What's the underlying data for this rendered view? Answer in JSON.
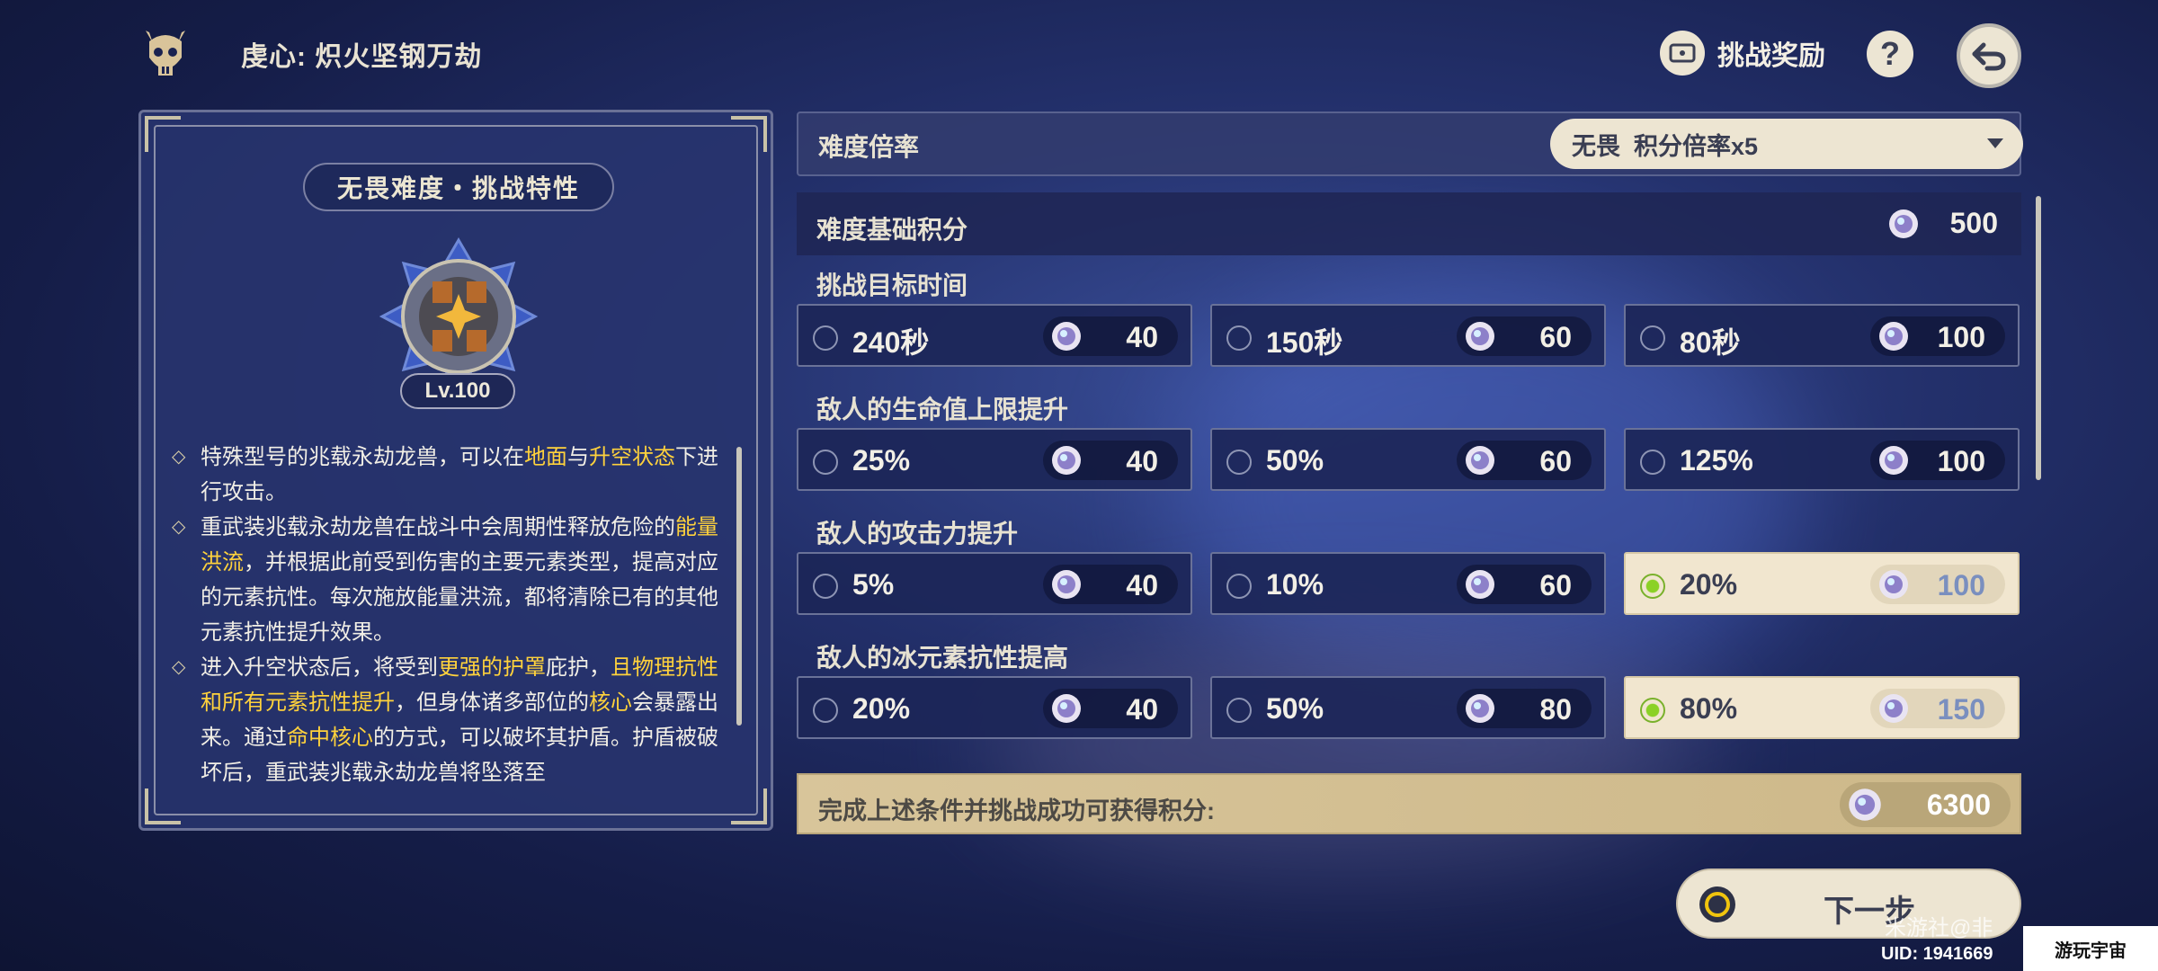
{
  "header": {
    "title": "虔心: 炽火坚钢万劫",
    "reward_label": "挑战奖励",
    "help_label": "?"
  },
  "left_panel": {
    "heading": "无畏难度・挑战特性",
    "level": "Lv.100",
    "desc": [
      {
        "parts": [
          {
            "t": "特殊型号的兆载永劫龙兽，可以在"
          },
          {
            "t": "地面",
            "h": true
          },
          {
            "t": "与"
          },
          {
            "t": "升空状态",
            "h": true
          },
          {
            "t": "下进行攻击。"
          }
        ]
      },
      {
        "parts": [
          {
            "t": "重武装兆载永劫龙兽在战斗中会周期性释放危险的"
          },
          {
            "t": "能量洪流",
            "h": true
          },
          {
            "t": "，并根据此前受到伤害的主要元素类型，提高对应的元素抗性。每次施放能量洪流，都将清除已有的其他元素抗性提升效果。"
          }
        ]
      },
      {
        "parts": [
          {
            "t": "进入升空状态后，将受到"
          },
          {
            "t": "更强的护罩",
            "h": true
          },
          {
            "t": "庇护，"
          },
          {
            "t": "且物理抗性和所有元素抗性提升",
            "h": true
          },
          {
            "t": "，但身体诸多部位的"
          },
          {
            "t": "核心",
            "h": true
          },
          {
            "t": "会暴露出来。通过"
          },
          {
            "t": "命中核心",
            "h": true
          },
          {
            "t": "的方式，可以破坏其护盾。护盾被破坏后，重武装兆载永劫龙兽将坠落至"
          }
        ]
      }
    ]
  },
  "difficulty": {
    "label": "难度倍率",
    "selected": "无畏  积分倍率x5"
  },
  "base": {
    "label": "难度基础积分",
    "value": "500"
  },
  "sections": [
    {
      "label": "挑战目标时间",
      "options": [
        {
          "label": "240秒",
          "points": "40",
          "selected": false
        },
        {
          "label": "150秒",
          "points": "60",
          "selected": false
        },
        {
          "label": "80秒",
          "points": "100",
          "selected": false
        }
      ]
    },
    {
      "label": "敌人的生命值上限提升",
      "options": [
        {
          "label": "25%",
          "points": "40",
          "selected": false
        },
        {
          "label": "50%",
          "points": "60",
          "selected": false
        },
        {
          "label": "125%",
          "points": "100",
          "selected": false
        }
      ]
    },
    {
      "label": "敌人的攻击力提升",
      "options": [
        {
          "label": "5%",
          "points": "40",
          "selected": false
        },
        {
          "label": "10%",
          "points": "60",
          "selected": false
        },
        {
          "label": "20%",
          "points": "100",
          "selected": true
        }
      ]
    },
    {
      "label": "敌人的冰元素抗性提高",
      "options": [
        {
          "label": "20%",
          "points": "40",
          "selected": false
        },
        {
          "label": "50%",
          "points": "80",
          "selected": false
        },
        {
          "label": "80%",
          "points": "150",
          "selected": true
        }
      ]
    }
  ],
  "total": {
    "label": "完成上述条件并挑战成功可获得积分:",
    "value": "6300"
  },
  "next_label": "下一步",
  "watermark": "米游社@非",
  "uid": "UID: 1941669",
  "brand": "游玩宇宙"
}
